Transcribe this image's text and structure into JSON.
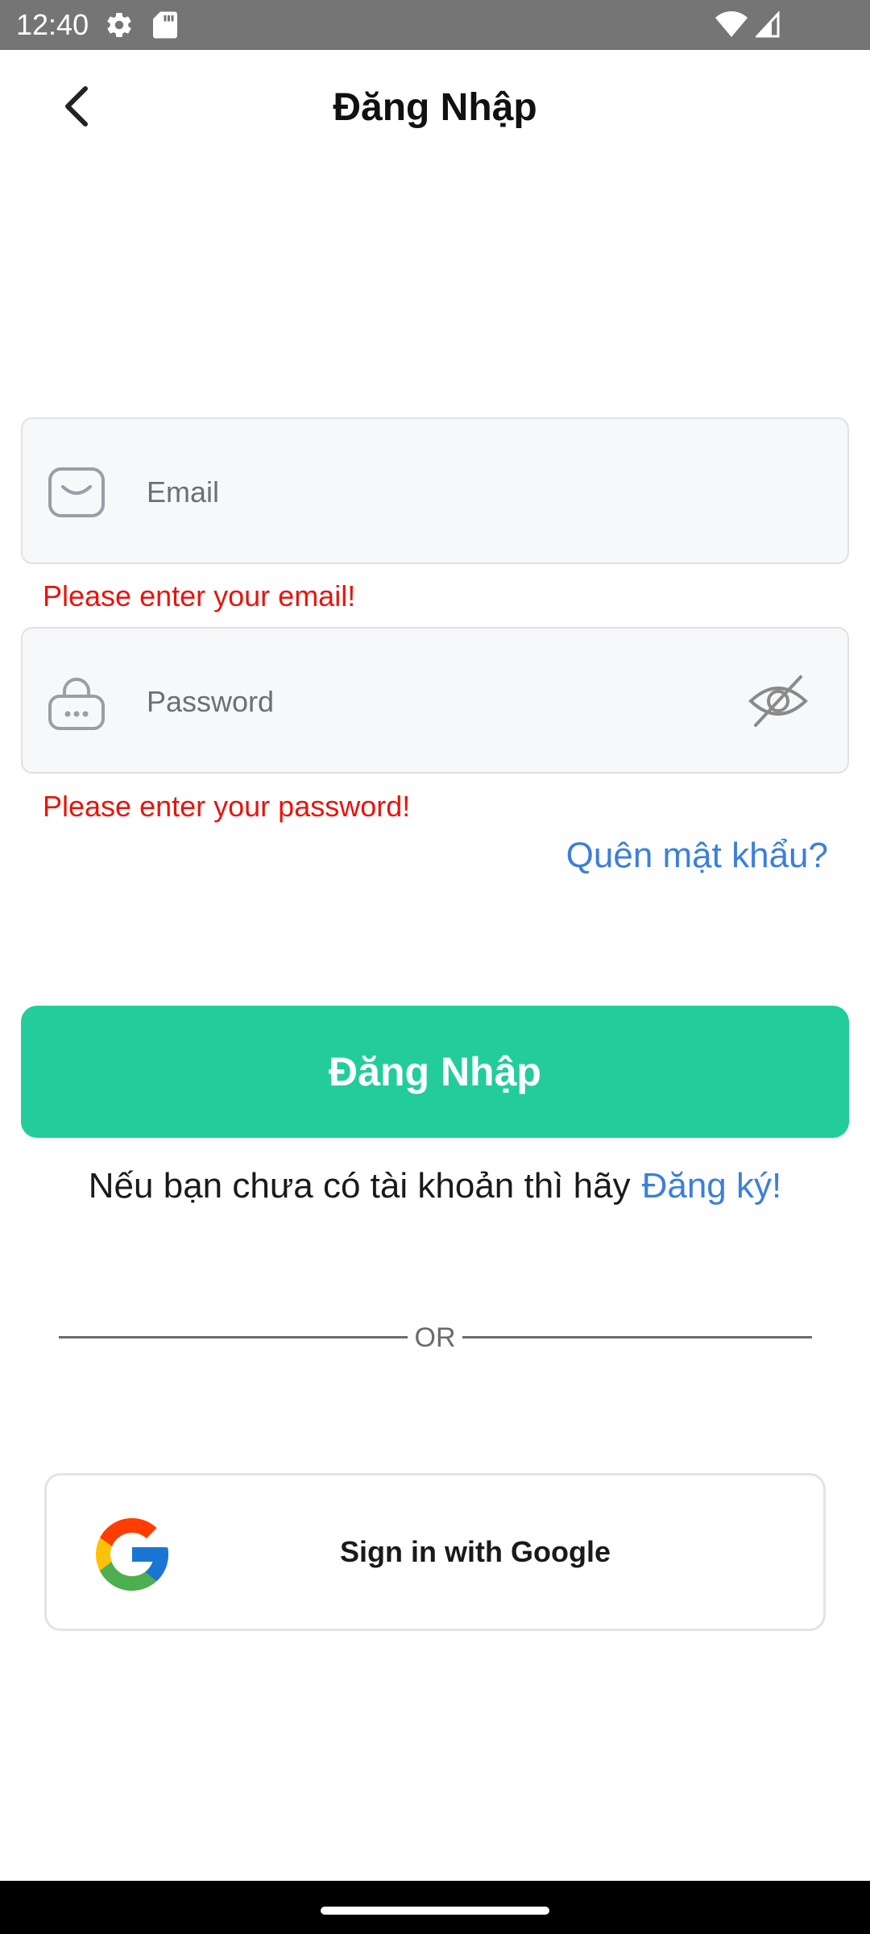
{
  "status_bar": {
    "time": "12:40",
    "icons": [
      "gear-icon",
      "sd-card-icon",
      "wifi-icon",
      "signal-icon"
    ]
  },
  "header": {
    "title": "Đăng Nhập",
    "back_icon": "chevron-left-icon"
  },
  "form": {
    "email": {
      "placeholder": "Email",
      "value": "",
      "icon": "mail-icon",
      "error": "Please enter your email!"
    },
    "password": {
      "placeholder": "Password",
      "value": "",
      "icon": "lock-icon",
      "toggle_icon": "eye-off-icon",
      "error": "Please enter your password!"
    },
    "forgot_password": "Quên mật khẩu?",
    "submit_label": "Đăng Nhập"
  },
  "signup": {
    "prompt": "Nếu bạn chưa có tài khoản thì hãy",
    "link": "Đăng ký!"
  },
  "divider": {
    "text": "OR"
  },
  "google": {
    "label": "Sign in with Google",
    "icon": "google-logo-icon"
  },
  "colors": {
    "primary": "#22cd9b",
    "link": "#3b7fdc",
    "error": "#e8140c",
    "status_bar": "#757575",
    "input_bg": "#f7f8fa"
  }
}
